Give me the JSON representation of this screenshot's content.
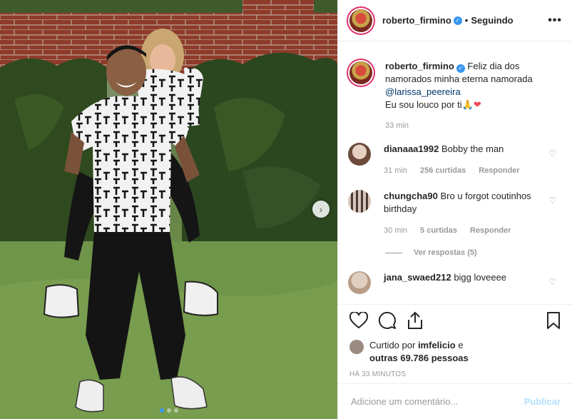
{
  "post": {
    "username": "roberto_firmino",
    "follow_status": "Seguindo",
    "separator": "•",
    "more_label": "•••"
  },
  "caption": {
    "username": "roberto_firmino",
    "text": "Feliz dia dos namorados minha eterna namorada",
    "mention": "@larissa_peereira",
    "line2": "Eu sou louco por ti",
    "emojis": "🙏❤",
    "time": "33 min"
  },
  "comments": [
    {
      "username": "dianaaa1992",
      "text": "Bobby the man",
      "time": "31 min",
      "likes": "256 curtidas",
      "reply": "Responder"
    },
    {
      "username": "chungcha90",
      "text": "Bro u forgot coutinhos birthday",
      "time": "30 min",
      "likes": "5 curtidas",
      "reply": "Responder",
      "view_replies": "Ver respostas (5)"
    },
    {
      "username": "jana_swaed212",
      "text": "bigg loveeee"
    }
  ],
  "likes_info": {
    "prefix": "Curtido por",
    "liker": "imfelicio",
    "connector": "e",
    "others": "outras 69.786 pessoas"
  },
  "timestamp": "HÁ 33 MINUTOS",
  "comment_box": {
    "placeholder": "Adicione um comentário...",
    "publish": "Publicar"
  },
  "icons": [
    "heart-icon",
    "comment-icon",
    "share-icon",
    "bookmark-icon",
    "chevron-right-icon",
    "verified-icon"
  ],
  "colors": {
    "accent": "#3897f0",
    "publish_disabled": "#b2dffc",
    "heart": "#ed4956",
    "mention": "#003569"
  },
  "carousel": {
    "count": 3,
    "active": 1
  }
}
